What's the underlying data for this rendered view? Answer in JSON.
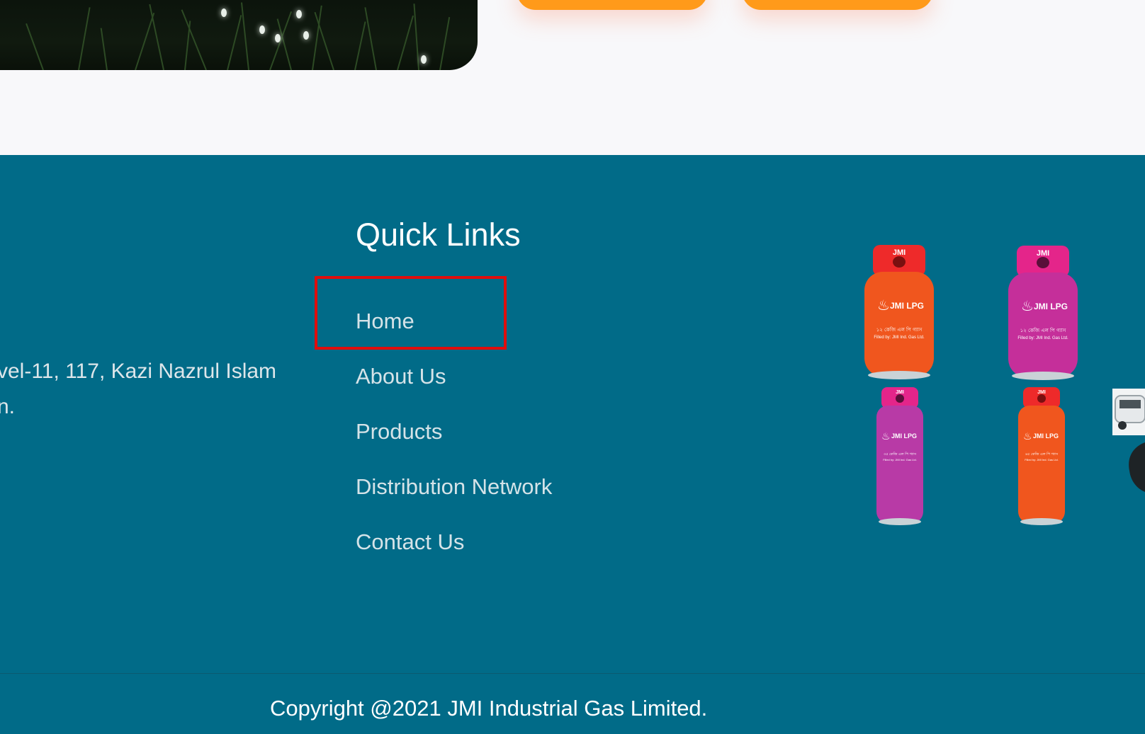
{
  "footer": {
    "address_line1": "vel-11, 117, Kazi Nazrul Islam",
    "address_line2": "n.",
    "quick_links": {
      "title": "Quick Links",
      "items": [
        {
          "label": "Home"
        },
        {
          "label": "About Us"
        },
        {
          "label": "Products"
        },
        {
          "label": "Distribution Network"
        },
        {
          "label": "Contact Us"
        }
      ]
    },
    "products": [
      {
        "brand_top": "JMI",
        "label": "JMI LPG",
        "bangla": "১২ কেজি এল পি গ্যাস",
        "filled": "Filled by: JMI Ind. Gas Ltd.",
        "color": "#f0561e",
        "neck_color": "#ee2a2a"
      },
      {
        "brand_top": "JMI",
        "label": "JMI LPG",
        "bangla": "১২ কেজি এল পি গ্যাস",
        "filled": "Filled by: JMI Ind. Gas Ltd.",
        "color": "#c52f9a",
        "neck_color": "#e4258a"
      },
      {
        "brand_top": "JMI",
        "label": "JMI LPG",
        "bangla": "৩৫ কেজি এল পি গ্যাস",
        "filled": "Filled by: JMI Ind. Gas Ltd.",
        "color": "#b83aa6",
        "neck_color": "#e4258a"
      },
      {
        "brand_top": "JMI",
        "label": "JMI LPG",
        "bangla": "৪৫ কেজি এল পি গ্যাস",
        "filled": "Filled by: JMI Ind. Gas Ltd.",
        "color": "#f0561e",
        "neck_color": "#ee2a2a"
      }
    ],
    "copyright": "Copyright @2021 JMI Industrial Gas Limited."
  },
  "colors": {
    "footer_bg": "#016b88",
    "accent_button": "#ff9a1a",
    "highlight_border": "#e00d0d",
    "page_bg": "#f8f8fa"
  }
}
